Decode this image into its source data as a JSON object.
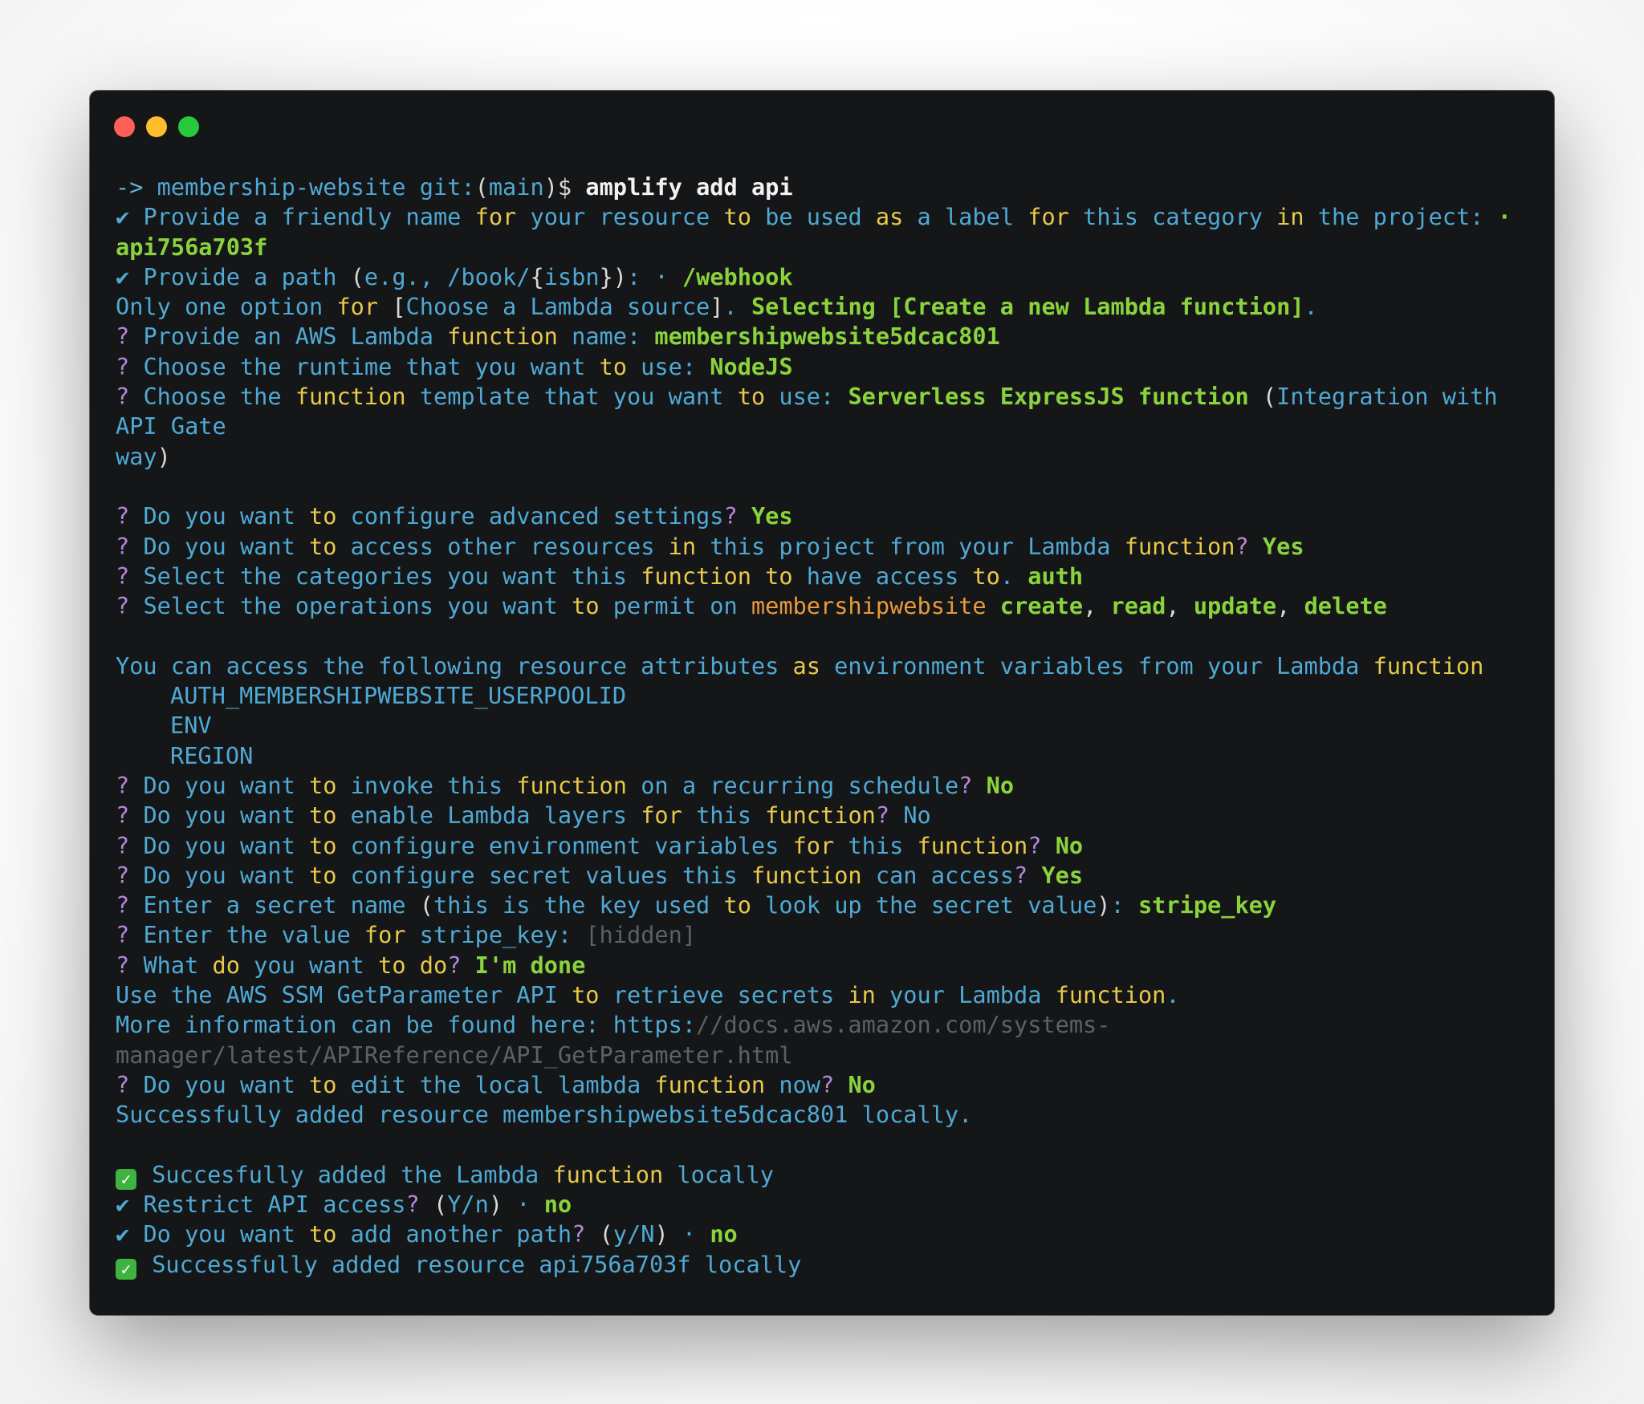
{
  "colors": {
    "background": "#ffffff",
    "terminal_bg": "#151618",
    "close_light": "#ff5f56",
    "minimize_light": "#ffbd2e",
    "maximize_light": "#27c93f",
    "text_blue": "#4fa9d4",
    "text_green": "#8ad33d",
    "text_yellow": "#e8c94a",
    "text_orange": "#ea9a3a",
    "text_purple": "#b586d8",
    "text_gray": "#5d6066"
  },
  "icons": {
    "close": "close-window-dot",
    "minimize": "minimize-window-dot",
    "maximize": "maximize-window-dot",
    "check": "checkmark-icon",
    "box_check": "green-checkbox-icon"
  },
  "lines": [
    [
      {
        "t": "-> ",
        "c": "arrow"
      },
      {
        "t": "membership-website ",
        "c": "prompt"
      },
      {
        "t": "git:",
        "c": "prompt"
      },
      {
        "t": "(",
        "c": "normal"
      },
      {
        "t": "main",
        "c": "prompt"
      },
      {
        "t": ")$ ",
        "c": "normal"
      },
      {
        "t": "amplify add api",
        "c": "white"
      }
    ],
    [
      {
        "t": "✔ ",
        "c": "blue"
      },
      {
        "t": "Provide a friendly name ",
        "c": "blue"
      },
      {
        "t": "for",
        "c": "yellow"
      },
      {
        "t": " your resource ",
        "c": "blue"
      },
      {
        "t": "to",
        "c": "yellow"
      },
      {
        "t": " be used ",
        "c": "blue"
      },
      {
        "t": "as",
        "c": "yellow"
      },
      {
        "t": " a label ",
        "c": "blue"
      },
      {
        "t": "for",
        "c": "yellow"
      },
      {
        "t": " this category ",
        "c": "blue"
      },
      {
        "t": "in",
        "c": "yellow"
      },
      {
        "t": " the project: ",
        "c": "blue"
      },
      {
        "t": "·",
        "c": "green"
      }
    ],
    [
      {
        "t": "api756a703f",
        "c": "green"
      }
    ],
    [
      {
        "t": "✔ ",
        "c": "blue"
      },
      {
        "t": "Provide a path ",
        "c": "blue"
      },
      {
        "t": "(",
        "c": "normal"
      },
      {
        "t": "e.g., /book/",
        "c": "blue"
      },
      {
        "t": "{",
        "c": "normal"
      },
      {
        "t": "isbn",
        "c": "blue"
      },
      {
        "t": "}",
        "c": "normal"
      },
      {
        "t": ")",
        "c": "normal"
      },
      {
        "t": ": · ",
        "c": "blue"
      },
      {
        "t": "/webhook",
        "c": "green"
      }
    ],
    [
      {
        "t": "Only one option ",
        "c": "blue"
      },
      {
        "t": "for",
        "c": "yellow"
      },
      {
        "t": " ",
        "c": "blue"
      },
      {
        "t": "[",
        "c": "normal"
      },
      {
        "t": "Choose a Lambda source",
        "c": "blue"
      },
      {
        "t": "]",
        "c": "normal"
      },
      {
        "t": ". ",
        "c": "blue"
      },
      {
        "t": "Selecting [Create a new Lambda function]",
        "c": "green"
      },
      {
        "t": ".",
        "c": "blue"
      }
    ],
    [
      {
        "t": "? ",
        "c": "purple"
      },
      {
        "t": "Provide an AWS Lambda ",
        "c": "blue"
      },
      {
        "t": "function",
        "c": "yellow"
      },
      {
        "t": " name: ",
        "c": "blue"
      },
      {
        "t": "membershipwebsite5dcac801",
        "c": "green"
      }
    ],
    [
      {
        "t": "? ",
        "c": "purple"
      },
      {
        "t": "Choose the runtime that you want ",
        "c": "blue"
      },
      {
        "t": "to",
        "c": "yellow"
      },
      {
        "t": " use: ",
        "c": "blue"
      },
      {
        "t": "NodeJS",
        "c": "green"
      }
    ],
    [
      {
        "t": "? ",
        "c": "purple"
      },
      {
        "t": "Choose the ",
        "c": "blue"
      },
      {
        "t": "function",
        "c": "yellow"
      },
      {
        "t": " template that you want ",
        "c": "blue"
      },
      {
        "t": "to",
        "c": "yellow"
      },
      {
        "t": " use: ",
        "c": "blue"
      },
      {
        "t": "Serverless ExpressJS function",
        "c": "green"
      },
      {
        "t": " ",
        "c": "blue"
      },
      {
        "t": "(",
        "c": "normal"
      },
      {
        "t": "Integration with",
        "c": "blue"
      }
    ],
    [
      {
        "t": "API Gate",
        "c": "blue"
      }
    ],
    [
      {
        "t": "way",
        "c": "blue"
      },
      {
        "t": ")",
        "c": "normal"
      }
    ],
    [],
    [
      {
        "t": "? ",
        "c": "purple"
      },
      {
        "t": "Do you want ",
        "c": "blue"
      },
      {
        "t": "to",
        "c": "yellow"
      },
      {
        "t": " configure advanced settings",
        "c": "blue"
      },
      {
        "t": "? ",
        "c": "purple"
      },
      {
        "t": "Yes",
        "c": "green"
      }
    ],
    [
      {
        "t": "? ",
        "c": "purple"
      },
      {
        "t": "Do you want ",
        "c": "blue"
      },
      {
        "t": "to",
        "c": "yellow"
      },
      {
        "t": " access other resources ",
        "c": "blue"
      },
      {
        "t": "in",
        "c": "yellow"
      },
      {
        "t": " this project from your Lambda ",
        "c": "blue"
      },
      {
        "t": "function",
        "c": "yellow"
      },
      {
        "t": "? ",
        "c": "purple"
      },
      {
        "t": "Yes",
        "c": "green"
      }
    ],
    [
      {
        "t": "? ",
        "c": "purple"
      },
      {
        "t": "Select the categories you want this ",
        "c": "blue"
      },
      {
        "t": "function",
        "c": "yellow"
      },
      {
        "t": " ",
        "c": "blue"
      },
      {
        "t": "to",
        "c": "yellow"
      },
      {
        "t": " have access ",
        "c": "blue"
      },
      {
        "t": "to",
        "c": "yellow"
      },
      {
        "t": ". ",
        "c": "blue"
      },
      {
        "t": "auth",
        "c": "green"
      }
    ],
    [
      {
        "t": "? ",
        "c": "purple"
      },
      {
        "t": "Select the operations you want ",
        "c": "blue"
      },
      {
        "t": "to",
        "c": "yellow"
      },
      {
        "t": " permit on ",
        "c": "blue"
      },
      {
        "t": "membershipwebsite",
        "c": "orange"
      },
      {
        "t": " ",
        "c": "blue"
      },
      {
        "t": "create",
        "c": "green"
      },
      {
        "t": ", ",
        "c": "normal"
      },
      {
        "t": "read",
        "c": "green"
      },
      {
        "t": ", ",
        "c": "normal"
      },
      {
        "t": "update",
        "c": "green"
      },
      {
        "t": ", ",
        "c": "normal"
      },
      {
        "t": "delete",
        "c": "green"
      }
    ],
    [],
    [
      {
        "t": "You can access the following resource attributes ",
        "c": "blue"
      },
      {
        "t": "as",
        "c": "yellow"
      },
      {
        "t": " environment variables from your Lambda ",
        "c": "blue"
      },
      {
        "t": "function",
        "c": "yellow"
      }
    ],
    [
      {
        "t": "AUTH_MEMBERSHIPWEBSITE_USERPOOLID",
        "c": "blue",
        "ind": true
      }
    ],
    [
      {
        "t": "ENV",
        "c": "blue",
        "ind": true
      }
    ],
    [
      {
        "t": "REGION",
        "c": "blue",
        "ind": true
      }
    ],
    [
      {
        "t": "? ",
        "c": "purple"
      },
      {
        "t": "Do you want ",
        "c": "blue"
      },
      {
        "t": "to",
        "c": "yellow"
      },
      {
        "t": " invoke this ",
        "c": "blue"
      },
      {
        "t": "function",
        "c": "yellow"
      },
      {
        "t": " on a recurring schedule",
        "c": "blue"
      },
      {
        "t": "? ",
        "c": "purple"
      },
      {
        "t": "No",
        "c": "green"
      }
    ],
    [
      {
        "t": "? ",
        "c": "purple"
      },
      {
        "t": "Do you want ",
        "c": "blue"
      },
      {
        "t": "to",
        "c": "yellow"
      },
      {
        "t": " enable Lambda layers ",
        "c": "blue"
      },
      {
        "t": "for",
        "c": "yellow"
      },
      {
        "t": " this ",
        "c": "blue"
      },
      {
        "t": "function",
        "c": "yellow"
      },
      {
        "t": "? ",
        "c": "purple"
      },
      {
        "t": "No",
        "c": "blue"
      }
    ],
    [
      {
        "t": "? ",
        "c": "purple"
      },
      {
        "t": "Do you want ",
        "c": "blue"
      },
      {
        "t": "to",
        "c": "yellow"
      },
      {
        "t": " configure environment variables ",
        "c": "blue"
      },
      {
        "t": "for",
        "c": "yellow"
      },
      {
        "t": " this ",
        "c": "blue"
      },
      {
        "t": "function",
        "c": "yellow"
      },
      {
        "t": "? ",
        "c": "purple"
      },
      {
        "t": "No",
        "c": "green"
      }
    ],
    [
      {
        "t": "? ",
        "c": "purple"
      },
      {
        "t": "Do you want ",
        "c": "blue"
      },
      {
        "t": "to",
        "c": "yellow"
      },
      {
        "t": " configure secret values this ",
        "c": "blue"
      },
      {
        "t": "function",
        "c": "yellow"
      },
      {
        "t": " can access",
        "c": "blue"
      },
      {
        "t": "? ",
        "c": "purple"
      },
      {
        "t": "Yes",
        "c": "green"
      }
    ],
    [
      {
        "t": "? ",
        "c": "purple"
      },
      {
        "t": "Enter a secret name ",
        "c": "blue"
      },
      {
        "t": "(",
        "c": "normal"
      },
      {
        "t": "this is the key used ",
        "c": "blue"
      },
      {
        "t": "to",
        "c": "yellow"
      },
      {
        "t": " look up the secret value",
        "c": "blue"
      },
      {
        "t": ")",
        "c": "normal"
      },
      {
        "t": ": ",
        "c": "blue"
      },
      {
        "t": "stripe_key",
        "c": "green"
      }
    ],
    [
      {
        "t": "? ",
        "c": "purple"
      },
      {
        "t": "Enter the value ",
        "c": "blue"
      },
      {
        "t": "for",
        "c": "yellow"
      },
      {
        "t": " stripe_key: ",
        "c": "blue"
      },
      {
        "t": "[hidden]",
        "c": "gray"
      }
    ],
    [
      {
        "t": "? ",
        "c": "purple"
      },
      {
        "t": "What ",
        "c": "blue"
      },
      {
        "t": "do",
        "c": "yellow"
      },
      {
        "t": " you want ",
        "c": "blue"
      },
      {
        "t": "to",
        "c": "yellow"
      },
      {
        "t": " ",
        "c": "blue"
      },
      {
        "t": "do",
        "c": "yellow"
      },
      {
        "t": "? ",
        "c": "purple"
      },
      {
        "t": "I'm done",
        "c": "green"
      }
    ],
    [
      {
        "t": "Use the AWS SSM GetParameter API ",
        "c": "blue"
      },
      {
        "t": "to",
        "c": "yellow"
      },
      {
        "t": " retrieve secrets ",
        "c": "blue"
      },
      {
        "t": "in",
        "c": "yellow"
      },
      {
        "t": " your Lambda ",
        "c": "blue"
      },
      {
        "t": "function",
        "c": "yellow"
      },
      {
        "t": ".",
        "c": "blue"
      }
    ],
    [
      {
        "t": "More information can be found here: https:",
        "c": "blue"
      },
      {
        "t": "//docs.aws.amazon.com/systems-",
        "c": "gray"
      }
    ],
    [
      {
        "t": "manager/latest/APIReference/API_GetParameter.html",
        "c": "gray"
      }
    ],
    [
      {
        "t": "? ",
        "c": "purple"
      },
      {
        "t": "Do you want ",
        "c": "blue"
      },
      {
        "t": "to",
        "c": "yellow"
      },
      {
        "t": " edit the local lambda ",
        "c": "blue"
      },
      {
        "t": "function",
        "c": "yellow"
      },
      {
        "t": " now",
        "c": "blue"
      },
      {
        "t": "? ",
        "c": "purple"
      },
      {
        "t": "No",
        "c": "green"
      }
    ],
    [
      {
        "t": "Successfully added resource membershipwebsite5dcac801 locally.",
        "c": "blue"
      }
    ],
    [],
    [
      {
        "t": "✓",
        "c": "box"
      },
      {
        "t": " Succesfully added the Lambda ",
        "c": "blue"
      },
      {
        "t": "function",
        "c": "yellow"
      },
      {
        "t": " locally",
        "c": "blue"
      }
    ],
    [
      {
        "t": "✔ ",
        "c": "blue"
      },
      {
        "t": "Restrict API access",
        "c": "blue"
      },
      {
        "t": "? ",
        "c": "purple"
      },
      {
        "t": "(",
        "c": "normal"
      },
      {
        "t": "Y/n",
        "c": "blue"
      },
      {
        "t": ")",
        "c": "normal"
      },
      {
        "t": " · ",
        "c": "blue"
      },
      {
        "t": "no",
        "c": "green"
      }
    ],
    [
      {
        "t": "✔ ",
        "c": "blue"
      },
      {
        "t": "Do you want ",
        "c": "blue"
      },
      {
        "t": "to",
        "c": "yellow"
      },
      {
        "t": " add another path",
        "c": "blue"
      },
      {
        "t": "? ",
        "c": "purple"
      },
      {
        "t": "(",
        "c": "normal"
      },
      {
        "t": "y/N",
        "c": "blue"
      },
      {
        "t": ")",
        "c": "normal"
      },
      {
        "t": " · ",
        "c": "blue"
      },
      {
        "t": "no",
        "c": "green"
      }
    ],
    [
      {
        "t": "✓",
        "c": "box"
      },
      {
        "t": " Successfully added resource api756a703f locally",
        "c": "blue"
      }
    ]
  ]
}
